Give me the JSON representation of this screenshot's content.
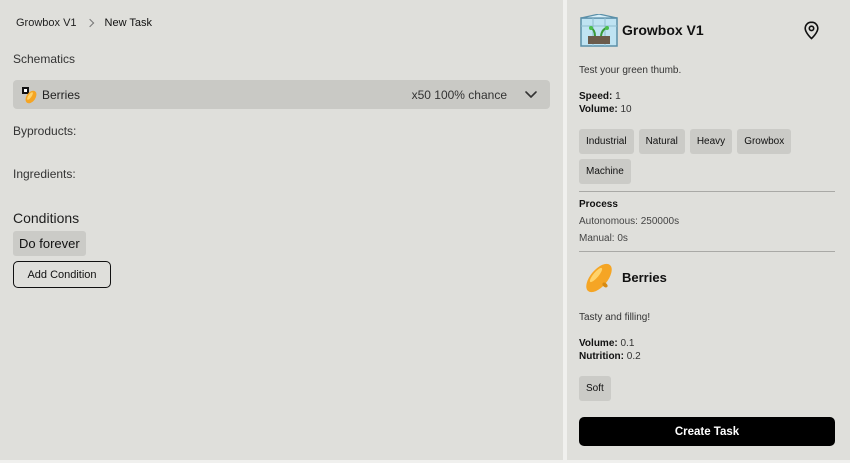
{
  "breadcrumb": {
    "parent": "Growbox V1",
    "current": "New Task"
  },
  "left": {
    "schematics_label": "Schematics",
    "selected_schematic": {
      "name": "Berries",
      "meta": "x50 100% chance",
      "icon": "berries-icon"
    },
    "byproducts_label": "Byproducts:",
    "ingredients_label": "Ingredients:",
    "conditions_label": "Conditions",
    "condition_chip": "Do forever",
    "add_condition_label": "Add Condition"
  },
  "machine": {
    "title": "Growbox V1",
    "description": "Test your green thumb.",
    "speed_label": "Speed:",
    "speed_value": "1",
    "volume_label": "Volume:",
    "volume_value": "10",
    "tags": [
      "Industrial",
      "Natural",
      "Heavy",
      "Growbox",
      "Machine"
    ],
    "process_title": "Process",
    "autonomous": "Autonomous: 250000s",
    "manual": "Manual: 0s"
  },
  "item": {
    "title": "Berries",
    "description": "Tasty and filling!",
    "volume_label": "Volume:",
    "volume_value": "0.1",
    "nutrition_label": "Nutrition:",
    "nutrition_value": "0.2",
    "tag": "Soft"
  },
  "actions": {
    "create_task": "Create Task"
  },
  "colors": {
    "panel_bg": "#dfdfdb",
    "select_bg": "#c9c9c5",
    "chip_bg": "#cbcbc7",
    "primary_button": "#000000",
    "berries_orange": "#f5a524"
  }
}
